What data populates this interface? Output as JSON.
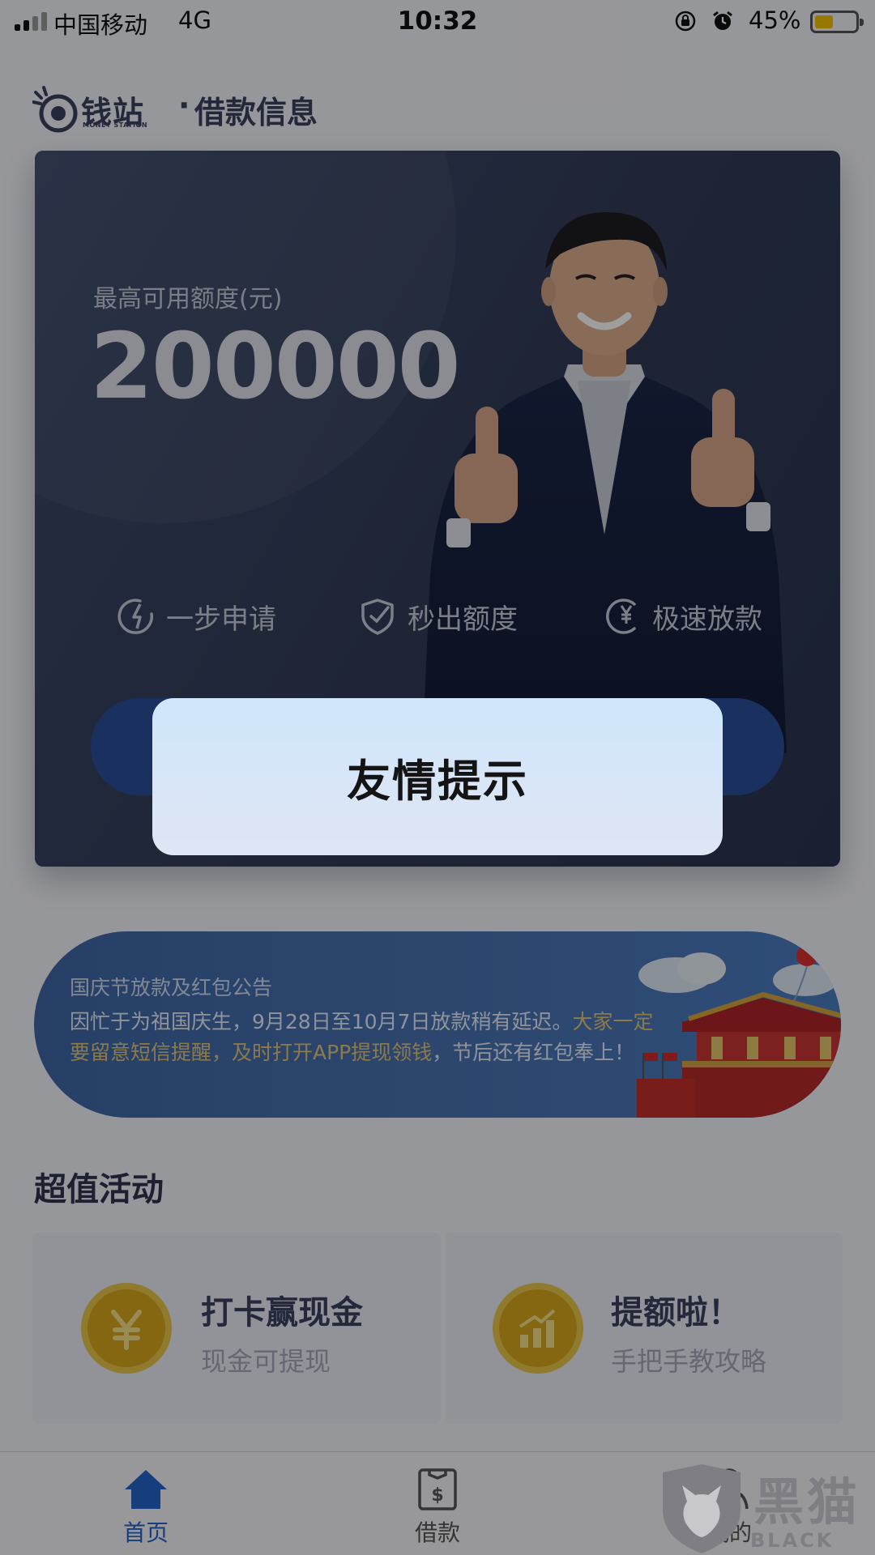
{
  "status_bar": {
    "carrier": "中国移动",
    "network": "4G",
    "time": "10:32",
    "battery_percent_text": "45%",
    "battery_level": 0.45,
    "icons": [
      "signal-icon",
      "orientation-lock-icon",
      "alarm-icon",
      "battery-icon"
    ]
  },
  "brand": {
    "logo_name": "钱站",
    "logo_sub": "MONEY STATION",
    "separator": "·",
    "page_title": "借款信息"
  },
  "hero": {
    "credit_label": "最高可用额度(元)",
    "credit_amount": "200000",
    "features": [
      {
        "icon": "lightning-circle-icon",
        "label": "一步申请"
      },
      {
        "icon": "shield-check-icon",
        "label": "秒出额度"
      },
      {
        "icon": "yen-circle-icon",
        "label": "极速放款"
      }
    ]
  },
  "dialog": {
    "title": "友情提示"
  },
  "notice": {
    "title": "国庆节放款及红包公告",
    "line1_main": "因忙于为祖国庆生，9月28日至10月7日放款稍有延迟。",
    "line1_highlight": "大家一定",
    "line2_highlight": "要留意短信提醒，及时打开APP提现领钱",
    "line2_main": "，节后还有红包奉上！"
  },
  "activities": {
    "section_title": "超值活动",
    "items": [
      {
        "icon": "yen-coin-icon",
        "title": "打卡赢现金",
        "subtitle": "现金可提现"
      },
      {
        "icon": "growth-coin-icon",
        "title": "提额啦！",
        "subtitle": "手把手教攻略"
      }
    ]
  },
  "tabbar": {
    "tabs": [
      {
        "icon": "home-icon",
        "label": "首页",
        "active": true
      },
      {
        "icon": "loan-bag-icon",
        "label": "借款",
        "active": false
      },
      {
        "icon": "user-icon",
        "label": "我的",
        "active": false
      }
    ]
  },
  "watermark": {
    "text": "黑猫",
    "sub": "BLACK CAT"
  },
  "colors": {
    "accent": "#2563c9",
    "hero_bg": "#323c58",
    "apply_button": "#2a4f9c",
    "coin": "#d7a51c",
    "highlight": "#e4c67a"
  }
}
